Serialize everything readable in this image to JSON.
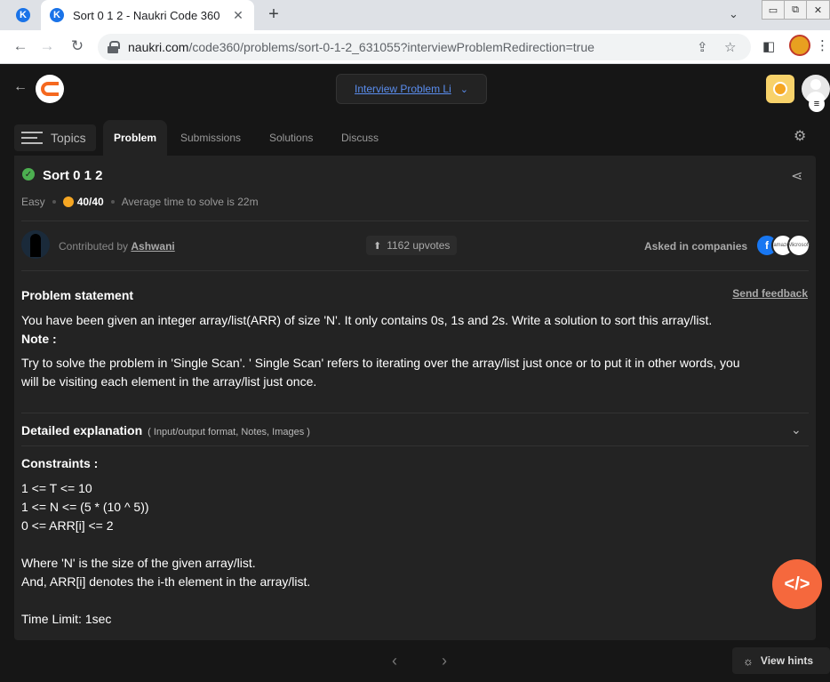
{
  "browser": {
    "inactive_tab_favicon": "K",
    "active_tab": {
      "favicon": "K",
      "title": "Sort 0 1 2 - Naukri Code 360",
      "close": "✕"
    },
    "new_tab": "+",
    "tab_search": "⌄",
    "window_controls": [
      "▭",
      "⧉",
      "✕"
    ],
    "url_host": "naukri.com",
    "url_path": "/code360/problems/sort-0-1-2_631055?interviewProblemRedirection=true"
  },
  "header": {
    "back": "←",
    "interview_list_label": "Interview Problem Li",
    "dropdown_chevron": "⌄",
    "menu_badge": "≡"
  },
  "tabs": {
    "topics": "Topics",
    "items": [
      "Problem",
      "Submissions",
      "Solutions",
      "Discuss"
    ]
  },
  "problem": {
    "title": "Sort 0 1 2",
    "difficulty": "Easy",
    "score": "40/40",
    "avg_time": "Average time to solve is 22m",
    "contributed_by": "Contributed by",
    "contributor": "Ashwani",
    "upvotes": "1162 upvotes",
    "asked_in": "Asked in companies",
    "companies": [
      "f",
      "amazon",
      "Microsoft"
    ],
    "statement_heading": "Problem statement",
    "send_feedback": "Send feedback",
    "statement": "You have been given an integer array/list(ARR) of size 'N'. It only contains 0s, 1s and 2s. Write a solution to sort this array/list.",
    "note_label": "Note :",
    "note_line1": "Try to solve the problem in 'Single Scan'. ' Single Scan' refers to iterating over the array/list just once or to put it in other words, you",
    "note_line2": "will be visiting each element in the array/list just once.",
    "detailed_heading": "Detailed explanation",
    "detailed_sub": "( Input/output format, Notes, Images )",
    "constraints_heading": "Constraints :",
    "constraints": [
      "1 <= T <= 10",
      "1 <= N <= (5 * (10 ^ 5))",
      "0 <= ARR[i] <= 2"
    ],
    "where_line1": "Where 'N' is the size of the given array/list.",
    "where_line2": "And, ARR[i] denotes the i-th element in the array/list.",
    "time_limit": "Time Limit: 1sec"
  },
  "footer": {
    "prev": "‹",
    "next": "›",
    "code_fab": "</>",
    "view_hints": "View hints"
  },
  "colors": {
    "accent": "#f5683d",
    "link": "#5a8dee",
    "success": "#4caf50",
    "panel": "#232323"
  }
}
